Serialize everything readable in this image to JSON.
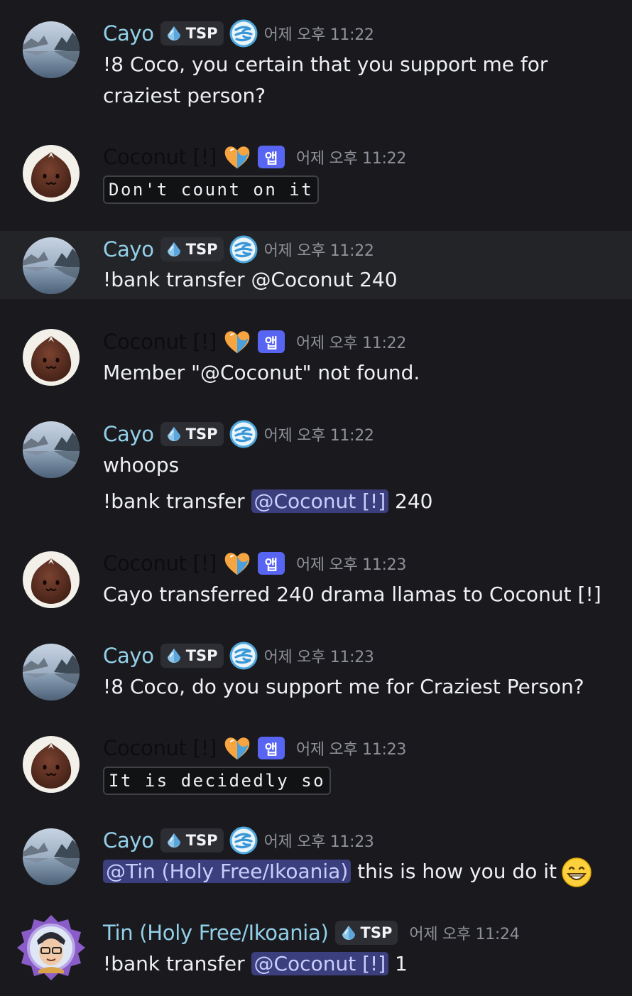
{
  "messages": [
    {
      "author": "Cayo",
      "tag": "TSP",
      "time": "어제 오후 11:22",
      "lines": [
        "!8 Coco, you certain that you support me for",
        "craziest person?"
      ]
    },
    {
      "author": "Coconut [!]",
      "app": "앱",
      "time": "어제 오후 11:22",
      "code": "Don't count on it"
    },
    {
      "author": "Cayo",
      "tag": "TSP",
      "time": "어제 오후 11:22",
      "text": "!bank transfer @Coconut 240"
    },
    {
      "author": "Coconut [!]",
      "app": "앱",
      "time": "어제 오후 11:22",
      "text": "Member \"@Coconut\" not found."
    },
    {
      "author": "Cayo",
      "tag": "TSP",
      "time": "어제 오후 11:22",
      "text": "whoops",
      "line2_prefix": "!bank transfer ",
      "line2_mention": "@Coconut [!]",
      "line2_suffix": " 240"
    },
    {
      "author": "Coconut [!]",
      "app": "앱",
      "time": "어제 오후 11:23",
      "text": "Cayo transferred 240 drama llamas to Coconut [!]"
    },
    {
      "author": "Cayo",
      "tag": "TSP",
      "time": "어제 오후 11:23",
      "text": "!8 Coco, do you support me for Craziest Person?"
    },
    {
      "author": "Coconut [!]",
      "app": "앱",
      "time": "어제 오후 11:23",
      "code": "It is decidedly so"
    },
    {
      "author": "Cayo",
      "tag": "TSP",
      "time": "어제 오후 11:23",
      "mention": "@Tin (Holy Free/Ikoania)",
      "text": " this is how you do it",
      "emoji": "grinning-face"
    },
    {
      "author": "Tin (Holy Free/Ikoania)",
      "tag": "TSP",
      "time": "어제 오후 11:24",
      "prefix": "!bank transfer ",
      "mention": "@Coconut [!]",
      "suffix": " 1"
    }
  ]
}
